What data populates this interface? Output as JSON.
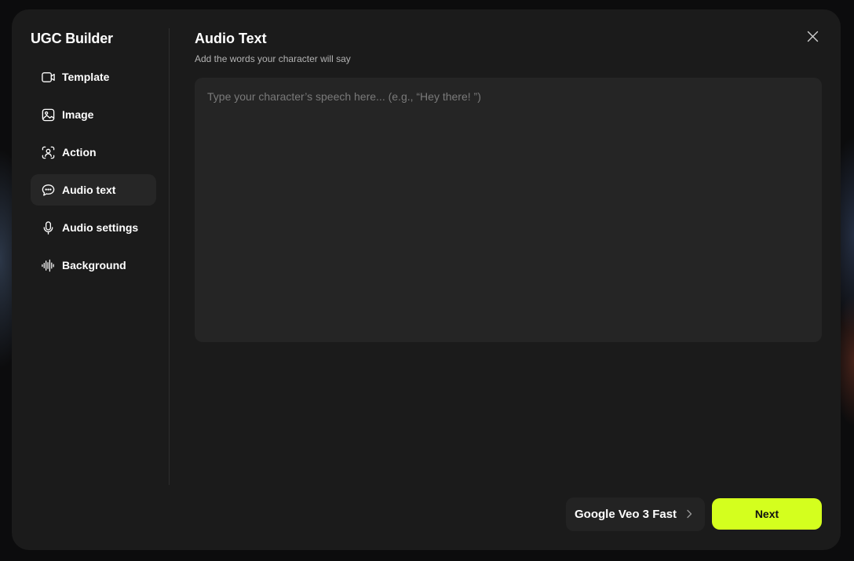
{
  "sidebar": {
    "brand": "UGC Builder",
    "items": [
      {
        "label": "Template",
        "icon": "template-icon",
        "active": false
      },
      {
        "label": "Image",
        "icon": "image-icon",
        "active": false
      },
      {
        "label": "Action",
        "icon": "action-icon",
        "active": false
      },
      {
        "label": "Audio text",
        "icon": "speech-bubble-icon",
        "active": true
      },
      {
        "label": "Audio settings",
        "icon": "microphone-icon",
        "active": false
      },
      {
        "label": "Background",
        "icon": "waveform-icon",
        "active": false
      }
    ]
  },
  "main": {
    "title": "Audio Text",
    "subtitle": "Add the words your character will say",
    "textarea": {
      "placeholder": "Type your character’s speech here... (e.g., “Hey there! ”)",
      "value": ""
    }
  },
  "footer": {
    "model_label": "Google Veo 3 Fast",
    "next_label": "Next"
  },
  "colors": {
    "accent": "#d4ff1e",
    "modal_bg": "#1b1b1b",
    "input_bg": "#252525"
  }
}
